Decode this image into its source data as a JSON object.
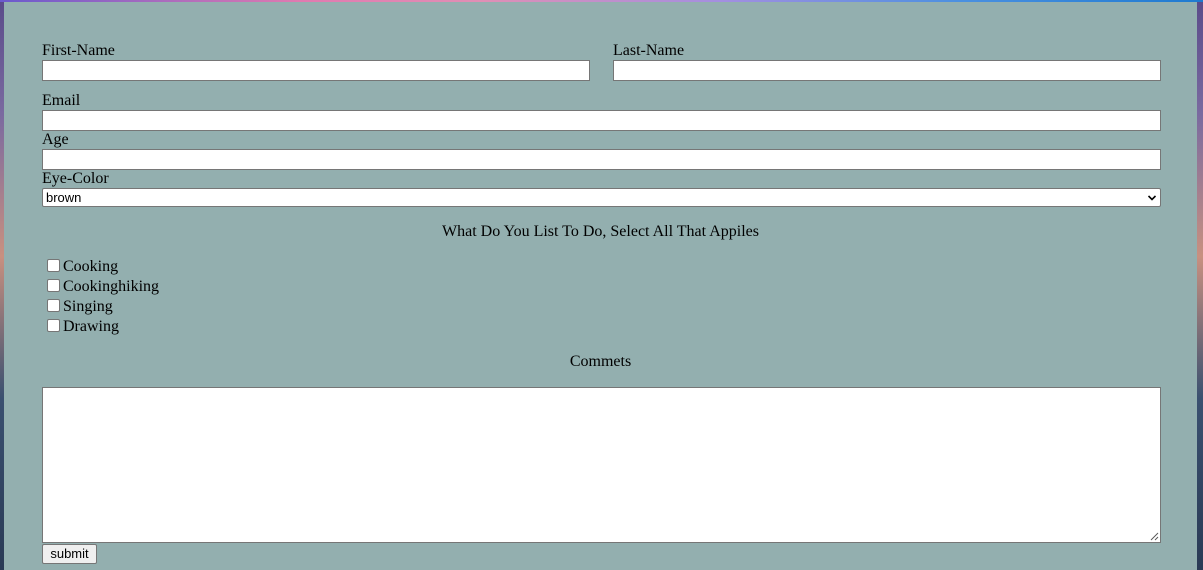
{
  "form": {
    "first_name_label": "First-Name",
    "first_name_value": "",
    "last_name_label": "Last-Name",
    "last_name_value": "",
    "email_label": "Email",
    "email_value": "",
    "age_label": "Age",
    "age_value": "",
    "eye_color_label": "Eye-Color",
    "eye_color_selected": "brown",
    "activities_heading": "What Do You List To Do, Select All That Appiles",
    "activities": [
      {
        "label": "Cooking",
        "checked": false
      },
      {
        "label": "Cookinghiking",
        "checked": false
      },
      {
        "label": "Singing",
        "checked": false
      },
      {
        "label": "Drawing",
        "checked": false
      }
    ],
    "comments_heading": "Commets",
    "comments_value": "",
    "submit_label": "submit"
  },
  "icons": {
    "select_arrow": "chevron-down-icon",
    "resize_grip": "resize-grip-icon"
  },
  "colors": {
    "panel_background": "#93afaf",
    "input_background": "#ffffff",
    "input_border": "#767676",
    "button_background": "#efefef"
  }
}
